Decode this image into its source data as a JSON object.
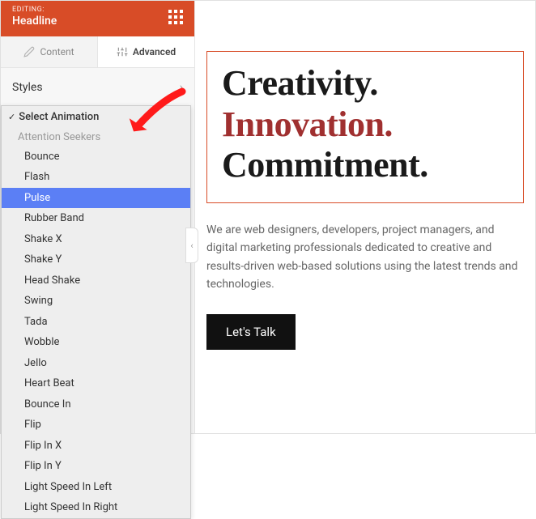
{
  "header": {
    "editing_label": "EDITING:",
    "block_name": "Headline"
  },
  "tabs": {
    "content": "Content",
    "advanced": "Advanced"
  },
  "section": {
    "title": "Styles"
  },
  "dropdown": {
    "label": "Select Animation",
    "group": "Attention Seekers",
    "options": [
      "Bounce",
      "Flash",
      "Pulse",
      "Rubber Band",
      "Shake X",
      "Shake Y",
      "Head Shake",
      "Swing",
      "Tada",
      "Wobble",
      "Jello",
      "Heart Beat",
      "Bounce In",
      "Flip",
      "Flip In X",
      "Flip In Y",
      "Light Speed In Left",
      "Light Speed In Right"
    ],
    "selected": "Pulse"
  },
  "preview": {
    "headline": {
      "w1": "Creativity.",
      "w2": "Innovation.",
      "w3": "Commitment."
    },
    "description": "We are web designers, developers, project managers, and digital marketing professionals dedicated to creative and results-driven web-based solutions using the latest trends and technologies.",
    "cta": "Let's Talk"
  }
}
